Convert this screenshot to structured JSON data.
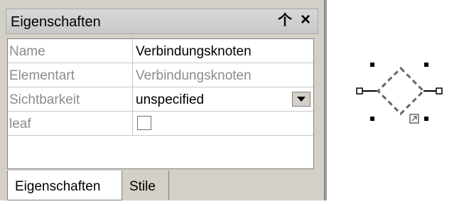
{
  "panel": {
    "title": "Eigenschaften",
    "pin_glyph": "⍅",
    "close_glyph": "✕"
  },
  "properties": [
    {
      "name": "Name",
      "value": "Verbindungsknoten",
      "value_style": "editable"
    },
    {
      "name": "Elementart",
      "value": "Verbindungsknoten",
      "value_style": "readonly"
    },
    {
      "name": "Sichtbarkeit",
      "value": "unspecified",
      "value_style": "dropdown"
    },
    {
      "name": "leaf",
      "value": "",
      "value_style": "checkbox",
      "checked": false
    }
  ],
  "tabs": [
    {
      "label": "Eigenschaften",
      "active": true
    },
    {
      "label": "Stile",
      "active": false
    }
  ],
  "diagram": {
    "element": "junction-node",
    "selected": true,
    "accent_color": "#666666"
  }
}
